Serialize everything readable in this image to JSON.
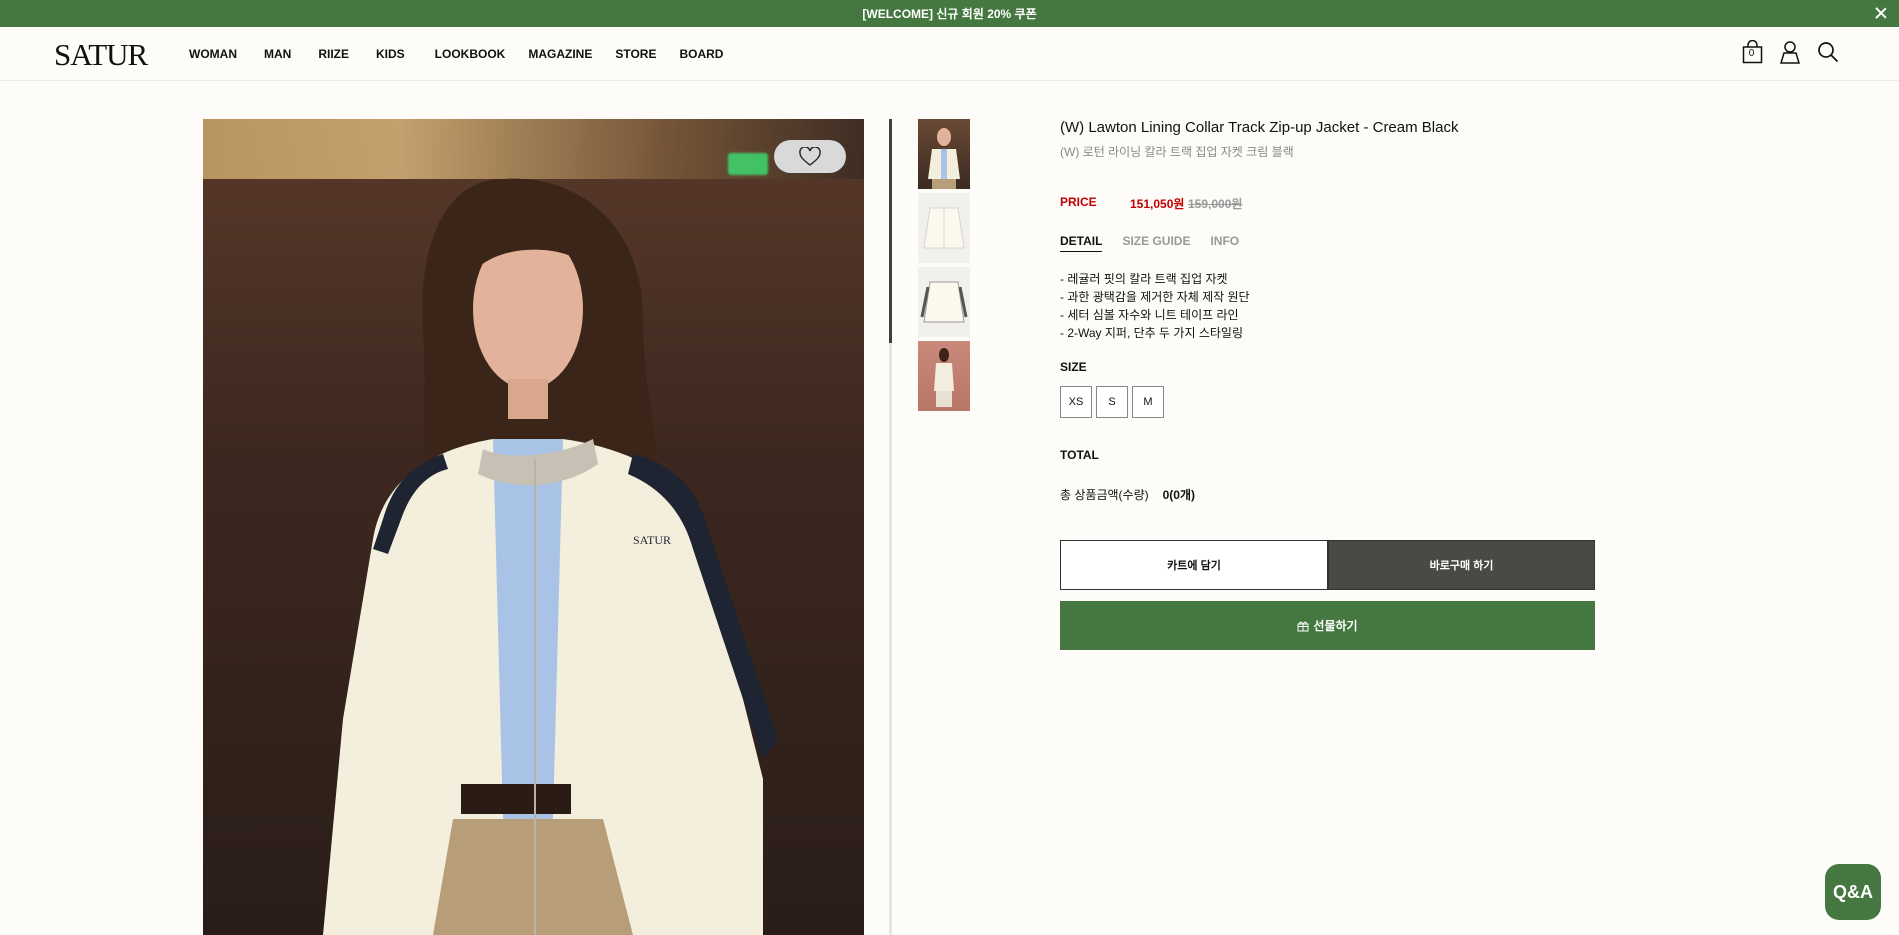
{
  "banner": {
    "text": "[WELCOME] 신규 회원 20% 쿠폰",
    "close_icon": "close-icon"
  },
  "header": {
    "logo": "SATUR",
    "nav": [
      "WOMAN",
      "MAN",
      "RIIZE",
      "KIDS",
      "LOOKBOOK",
      "MAGAZINE",
      "STORE",
      "BOARD"
    ],
    "cart_count": "0",
    "icons": [
      "cart-icon",
      "user-icon",
      "search-icon"
    ]
  },
  "gallery": {
    "wishlist_icon": "heart-icon",
    "thumbnails": 4
  },
  "product": {
    "title": "(W) Lawton Lining Collar Track Zip-up Jacket - Cream Black",
    "subtitle": "(W) 로턴 라이닝 칼라 트랙 집업 자켓 크림 블랙",
    "price_label": "PRICE",
    "price": "151,050원",
    "original_price": "159,000원",
    "tabs": [
      "DETAIL",
      "SIZE GUIDE",
      "INFO"
    ],
    "details": [
      "- 레귤러 핏의 칼라 트랙 집업 자켓",
      "- 과한 광택감을 제거한 자체 제작 원단",
      "- 세터 심볼 자수와 니트 테이프 라인",
      "- 2-Way 지퍼, 단추 두 가지 스타일링"
    ],
    "size_label": "SIZE",
    "sizes": [
      "XS",
      "S",
      "M"
    ],
    "total_label": "TOTAL",
    "total_row_label": "총 상품금액(수량)",
    "total_row_value": "0(0개)",
    "cart_button": "카트에 담기",
    "buy_button": "바로구매 하기",
    "gift_button": "선물하기"
  },
  "qa_button": "Q&A",
  "colors": {
    "brand_green": "#447840",
    "price_red": "#c00000",
    "dark_button": "#4a4945"
  }
}
